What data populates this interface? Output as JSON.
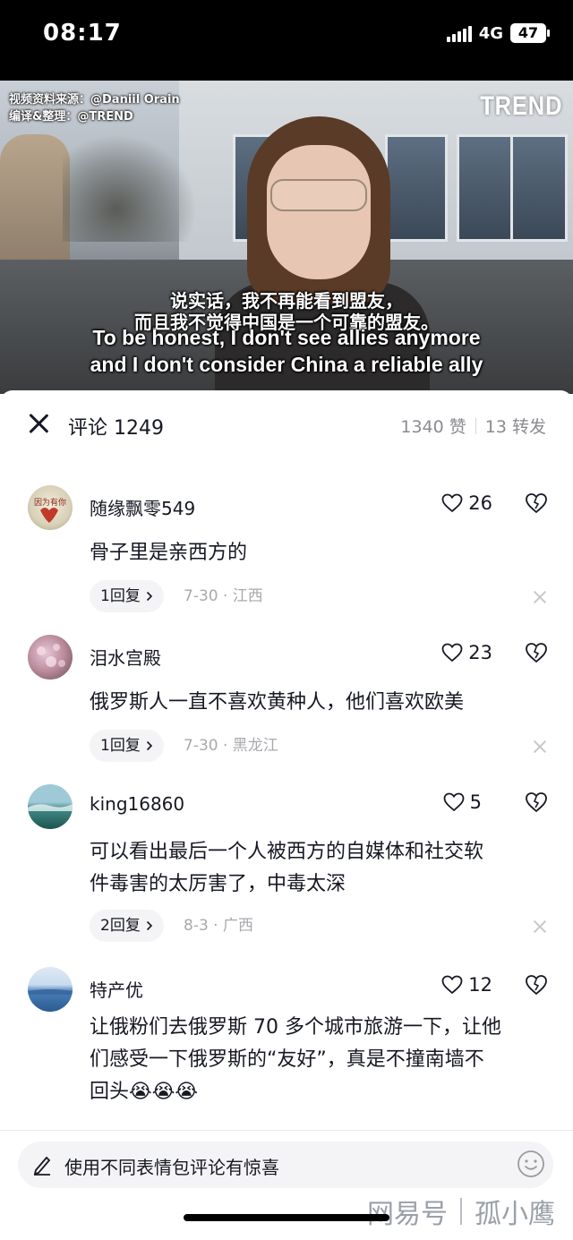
{
  "status_bar": {
    "time": "08:17",
    "network": "4G",
    "battery": "47"
  },
  "video": {
    "credit_line1": "视频资料来源：@Daniil Orain",
    "credit_line2": "编译&整理：@TREND",
    "logo": "TREND",
    "subtitle_zh_1": "说实话，我不再能看到盟友，",
    "subtitle_zh_2": "而且我不觉得中国是一个可靠的盟友。",
    "subtitle_en_1": "To be honest, I don't see allies anymore",
    "subtitle_en_2": "and I don't consider China a reliable ally"
  },
  "comments_header": {
    "title": "评论 1249",
    "likes": "1340 赞",
    "shares": "13 转发"
  },
  "comments": [
    {
      "username": "随缘飘零549",
      "likes": "26",
      "text": "骨子里是亲西方的",
      "reply_label": "1回复",
      "meta": "7-30 · 江西",
      "avatar_color": "#d8d0b8"
    },
    {
      "username": "泪水宫殿",
      "likes": "23",
      "text": "俄罗斯人一直不喜欢黄种人，他们喜欢欧美",
      "reply_label": "1回复",
      "meta": "7-30 · 黑龙江",
      "avatar_color": "#b98a9a"
    },
    {
      "username": "king16860",
      "likes": "5",
      "text_line1": "可以看出最后一个人被西方的自媒体和社交软",
      "text_line2": "件毒害的太厉害了，中毒太深",
      "reply_label": "2回复",
      "meta": "8-3 · 广西",
      "avatar_color": "#3f8a86"
    },
    {
      "username": "特产优",
      "likes": "12",
      "text_line1": "让俄粉们去俄罗斯 70 多个城市旅游一下，让他",
      "text_line2": "们感受一下俄罗斯的“友好”，真是不撞南墙不",
      "text_line3": "回头",
      "emoji": "😭😭😭",
      "avatar_color": "#4a7fb8"
    }
  ],
  "input": {
    "placeholder": "使用不同表情包评论有惊喜"
  },
  "watermark": {
    "left": "网易号",
    "right": "孤小鹰"
  },
  "icons": {
    "close": "close-icon",
    "heart": "heart-icon",
    "dislike": "heart-broken-icon",
    "chevron": "chevron-right-icon",
    "pencil": "pencil-icon",
    "smile": "smile-icon"
  }
}
